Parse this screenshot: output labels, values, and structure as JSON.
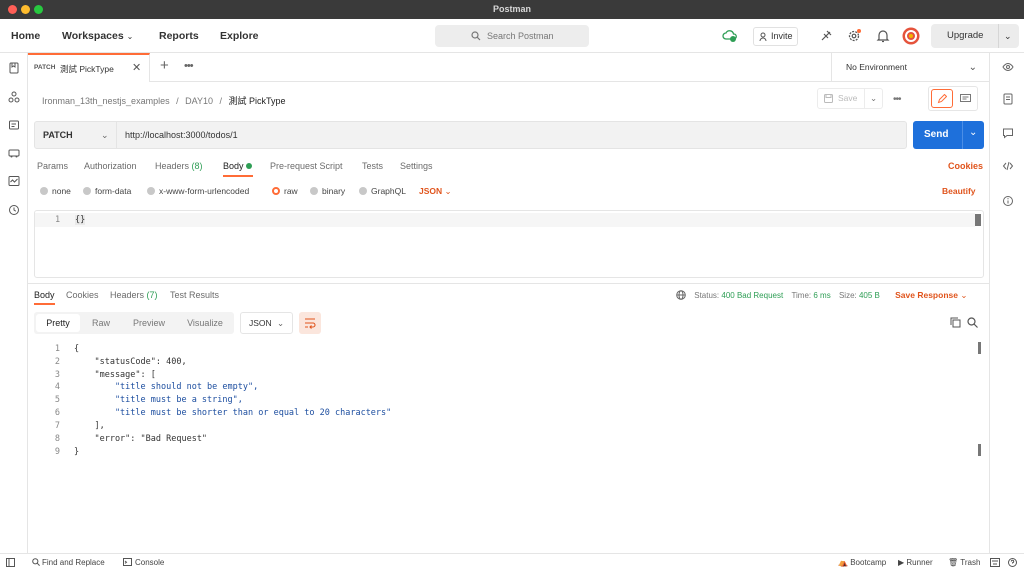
{
  "window": {
    "title": "Postman"
  },
  "nav": {
    "home": "Home",
    "workspaces": "Workspaces",
    "reports": "Reports",
    "explore": "Explore"
  },
  "search": {
    "placeholder": "Search Postman"
  },
  "header": {
    "invite": "Invite",
    "upgrade": "Upgrade"
  },
  "tab": {
    "method": "PATCH",
    "name": "測試 PickType"
  },
  "environment": {
    "label": "No Environment"
  },
  "breadcrumb": {
    "collection": "Ironman_13th_nestjs_examples",
    "folder": "DAY10",
    "request": "測試 PickType",
    "separator": "/"
  },
  "save": {
    "label": "Save"
  },
  "request": {
    "method": "PATCH",
    "url": "http://localhost:3000/todos/1"
  },
  "send": {
    "label": "Send"
  },
  "request_tabs": {
    "params": "Params",
    "authorization": "Authorization",
    "headers": "Headers",
    "headers_count": "(8)",
    "body": "Body",
    "prerequest": "Pre-request Script",
    "tests": "Tests",
    "settings": "Settings",
    "cookies": "Cookies"
  },
  "body_types": {
    "none": "none",
    "form_data": "form-data",
    "urlencoded": "x-www-form-urlencoded",
    "raw": "raw",
    "binary": "binary",
    "graphql": "GraphQL",
    "format": "JSON",
    "beautify": "Beautify"
  },
  "editor": {
    "line1_no": "1",
    "line1_code": "{}"
  },
  "response_tabs": {
    "body": "Body",
    "cookies": "Cookies",
    "headers": "Headers",
    "headers_count": "(7)",
    "test_results": "Test Results"
  },
  "response_status": {
    "status_label": "Status:",
    "status_value": "400 Bad Request",
    "time_label": "Time:",
    "time_value": "6 ms",
    "size_label": "Size:",
    "size_value": "405 B",
    "save_response": "Save Response"
  },
  "view_modes": {
    "pretty": "Pretty",
    "raw": "Raw",
    "preview": "Preview",
    "visualize": "Visualize",
    "format": "JSON"
  },
  "response_code": {
    "lines": [
      {
        "n": "1",
        "code": "{"
      },
      {
        "n": "2",
        "code": "    \"statusCode\": 400,"
      },
      {
        "n": "3",
        "code": "    \"message\": ["
      },
      {
        "n": "4",
        "code": "        \"title should not be empty\","
      },
      {
        "n": "5",
        "code": "        \"title must be a string\","
      },
      {
        "n": "6",
        "code": "        \"title must be shorter than or equal to 20 characters\""
      },
      {
        "n": "7",
        "code": "    ],"
      },
      {
        "n": "8",
        "code": "    \"error\": \"Bad Request\""
      },
      {
        "n": "9",
        "code": "}"
      }
    ]
  },
  "footer": {
    "find_replace": "Find and Replace",
    "console": "Console",
    "bootcamp": "Bootcamp",
    "runner": "Runner",
    "trash": "Trash"
  },
  "colors": {
    "accent": "#ff6c37",
    "send": "#1e70db",
    "status_ok_green": "#2e9e55",
    "json_key": "#a63d1a",
    "json_string": "#1e4fa0",
    "json_number": "#3a7d44"
  }
}
